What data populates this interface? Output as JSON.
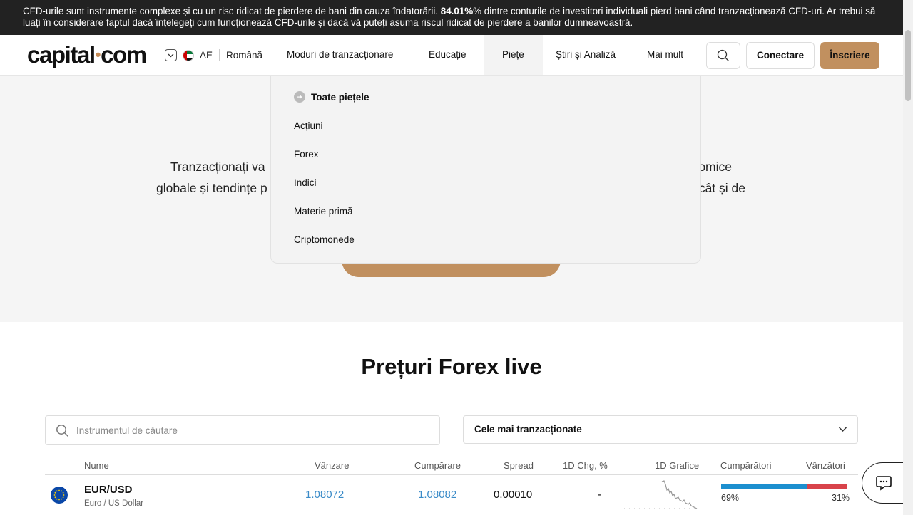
{
  "risk_warning": {
    "part1": "CFD-urile sunt instrumente complexe și cu un risc ridicat de pierdere de bani din cauza îndatorării. ",
    "percent": "84.01%",
    "part2": "% dintre conturile de investitori individuali pierd bani când tranzacționează CFD-uri. Ar trebui să luați în considerare faptul dacă înțelegeți cum funcționează CFD-urile și dacă vă puteți asuma riscul ridicat de pierdere a banilor dumneavoastră."
  },
  "header": {
    "logo_left": "capital",
    "logo_dot": "•",
    "logo_right": "com",
    "region_code": "AE",
    "language": "Română",
    "nav": [
      "Moduri de tranzacționare",
      "Educație",
      "Piețe",
      "Știri și Analiză",
      "Mai mult"
    ],
    "login_label": "Conectare",
    "signup_label": "Înscriere"
  },
  "hero": {
    "line1_left": "Tranzacționați va",
    "line1_right": "omice",
    "line2_left": "globale și tendințe p",
    "line2_right": "cât și de"
  },
  "markets_dropdown": {
    "all_label": "Toate piețele",
    "items": [
      "Acțiuni",
      "Forex",
      "Indici",
      "Materie primă",
      "Criptomonede"
    ]
  },
  "section_title": "Prețuri Forex live",
  "search": {
    "placeholder": "Instrumentul de căutare"
  },
  "sort_select": {
    "selected": "Cele mai tranzacționate"
  },
  "table": {
    "headers": {
      "name": "Nume",
      "sell": "Vânzare",
      "buy": "Cumpărare",
      "spread": "Spread",
      "change": "1D Chg, %",
      "chart": "1D Grafice",
      "buyers": "Cumpărători",
      "sellers": "Vânzători"
    },
    "rows": [
      {
        "symbol": "EUR/USD",
        "description": "Euro / US Dollar",
        "sell": "1.08072",
        "buy": "1.08082",
        "spread": "0.00010",
        "change": "-",
        "buyers_pct": "69%",
        "sellers_pct": "31%",
        "buyers_share": 0.69
      }
    ]
  },
  "colors": {
    "accent": "#c1905f",
    "buy_bar": "#1c8fcf",
    "sell_bar": "#d8434a",
    "price": "#3a8bc8"
  }
}
